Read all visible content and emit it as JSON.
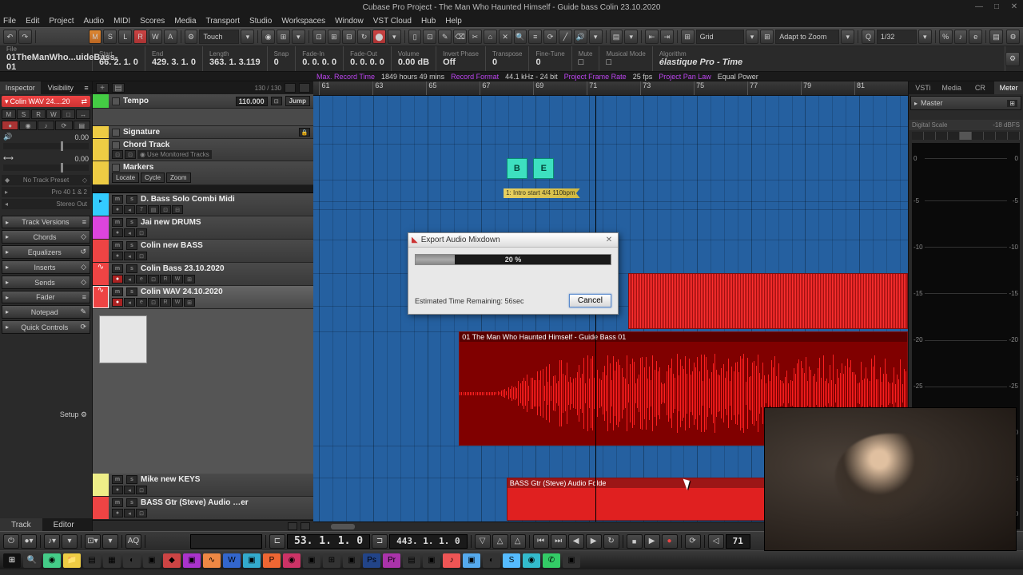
{
  "window": {
    "title": "Cubase Pro Project - The Man Who Haunted Himself - Guide bass Colin 23.10.2020"
  },
  "menu": [
    "File",
    "Edit",
    "Project",
    "Audio",
    "MIDI",
    "Scores",
    "Media",
    "Transport",
    "Studio",
    "Workspaces",
    "Window",
    "VST Cloud",
    "Hub",
    "Help"
  ],
  "toolbar": {
    "touch_mode": "Touch",
    "snap_mode": "Grid",
    "adapt": "Adapt to Zoom",
    "quantize": "1/32"
  },
  "info": {
    "file": {
      "label": "File",
      "value": "01TheManWho...uideBass-01"
    },
    "start": {
      "label": "Start",
      "value": "66. 2. 1. 0"
    },
    "end": {
      "label": "End",
      "value": "429. 3. 1. 0"
    },
    "length": {
      "label": "Length",
      "value": "363. 1. 3.119"
    },
    "snap": {
      "label": "Snap",
      "value": "0"
    },
    "fadein": {
      "label": "Fade-In",
      "value": "0. 0. 0. 0"
    },
    "fadeout": {
      "label": "Fade-Out",
      "value": "0. 0. 0. 0"
    },
    "volume": {
      "label": "Volume",
      "value": "0.00 dB"
    },
    "invert": {
      "label": "Invert Phase",
      "value": "Off"
    },
    "transpose": {
      "label": "Transpose",
      "value": "0"
    },
    "finetune": {
      "label": "Fine-Tune",
      "value": "0"
    },
    "mute": {
      "label": "Mute",
      "value": ""
    },
    "musical": {
      "label": "Musical Mode",
      "value": ""
    },
    "algorithm": {
      "label": "Algorithm",
      "value": "élastique Pro - Time"
    },
    "status": {
      "maxrec": "Max. Record Time",
      "maxrec_val": "1849 hours 49 mins",
      "format": "Record Format",
      "format_val": "44.1 kHz - 24 bit",
      "framerate": "Project Frame Rate",
      "framerate_val": "25 fps",
      "panlaw": "Project Pan Law",
      "panlaw_val": "Equal Power"
    }
  },
  "inspector": {
    "tabs": [
      "Inspector",
      "Visibility"
    ],
    "track_name": "Colin WAV 24....20",
    "buttons": [
      "M",
      "S",
      "R",
      "W",
      "□",
      "↔"
    ],
    "vol": "0.00",
    "pan": "0.00",
    "preset_label": "No Track Preset",
    "routing": "Pro 40 1 & 2",
    "out": "Stereo Out",
    "sections": [
      "Track Versions",
      "Chords",
      "Equalizers",
      "Inserts",
      "Sends",
      "Fader",
      "Notepad",
      "Quick Controls"
    ],
    "setup": "Setup"
  },
  "tracklist": {
    "zoom": "130 / 130",
    "tracks": [
      {
        "name": "Tempo",
        "type": "tempo",
        "tempo": "110.000",
        "jump": "Jump"
      },
      {
        "name": "Signature",
        "type": "signature"
      },
      {
        "name": "Chord Track",
        "type": "chord",
        "monitor": "Use Monitored Tracks"
      },
      {
        "name": "Markers",
        "type": "markers",
        "btns": [
          "Locate",
          "Cycle",
          "Zoom"
        ]
      },
      {
        "name": "D. Bass Solo Combi Midi",
        "type": "midi"
      },
      {
        "name": "Jai new DRUMS",
        "type": "drums"
      },
      {
        "name": "Colin new BASS",
        "type": "bass1"
      },
      {
        "name": "Colin Bass 23.10.2020",
        "type": "bass2"
      },
      {
        "name": "Colin WAV 24.10.2020",
        "type": "bass3",
        "selected": true
      },
      {
        "name": "Mike new KEYS",
        "type": "keys"
      },
      {
        "name": "BASS Gtr (Steve) Audio …er",
        "type": "gtr"
      }
    ],
    "bottom_tabs": [
      "Track",
      "Editor"
    ]
  },
  "ruler": {
    "bars": [
      "61",
      "63",
      "65",
      "67",
      "69",
      "71",
      "73",
      "75",
      "77",
      "79",
      "81"
    ]
  },
  "arrange": {
    "chord_b": "B",
    "chord_e": "E",
    "marker1": "1: Intro start 4/4 110bpm",
    "clip_wave": "01 The Man Who Haunted Himself - Guide Bass 01",
    "clip_gtr": "BASS Gtr (Steve) Audio Folde"
  },
  "right": {
    "tabs": [
      "VSTi",
      "Media",
      "CR",
      "Meter"
    ],
    "master": "Master",
    "scale": "Digital Scale",
    "scale_val": "-18 dBFS",
    "ticks": [
      "0",
      "-5",
      "-10",
      "-15",
      "-20",
      "-25",
      "-30",
      "-35",
      "-40"
    ]
  },
  "transport": {
    "pos": "53.  1.  1.   0",
    "sec": "443.  1.  1.   0",
    "end": "71"
  },
  "dialog": {
    "title": "Export Audio Mixdown",
    "percent": "20 %",
    "percent_val": 20,
    "eta": "Estimated Time Remaining: 56sec",
    "cancel": "Cancel"
  }
}
